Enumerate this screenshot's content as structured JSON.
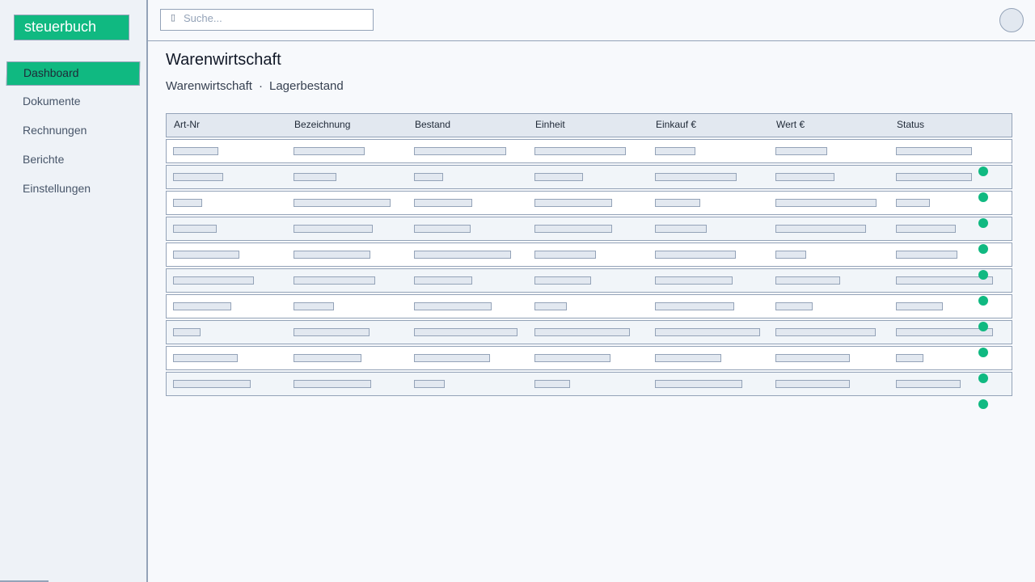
{
  "app": {
    "logo": "steuerbuch"
  },
  "sidebar": {
    "items": [
      {
        "label": "Dashboard",
        "active": true
      },
      {
        "label": "Dokumente"
      },
      {
        "label": "Rechnungen"
      },
      {
        "label": "Berichte"
      },
      {
        "label": "Einstellungen"
      }
    ]
  },
  "search": {
    "placeholder": "Suche..."
  },
  "page": {
    "title": "Warenwirtschaft",
    "breadcrumb": [
      "Warenwirtschaft",
      "Lagerbestand"
    ],
    "breadcrumb_separator": "·"
  },
  "table": {
    "columns": [
      "Art-Nr",
      "Bezeichnung",
      "Bestand",
      "Einheit",
      "Einkauf €",
      "Wert €",
      "Status"
    ],
    "row_count": 10
  },
  "colors": {
    "accent": "#10b981",
    "border": "#94a3b8",
    "placeholder_fill": "#e2e8f0"
  },
  "icons": {
    "search": "search-icon",
    "avatar": "user-avatar"
  }
}
